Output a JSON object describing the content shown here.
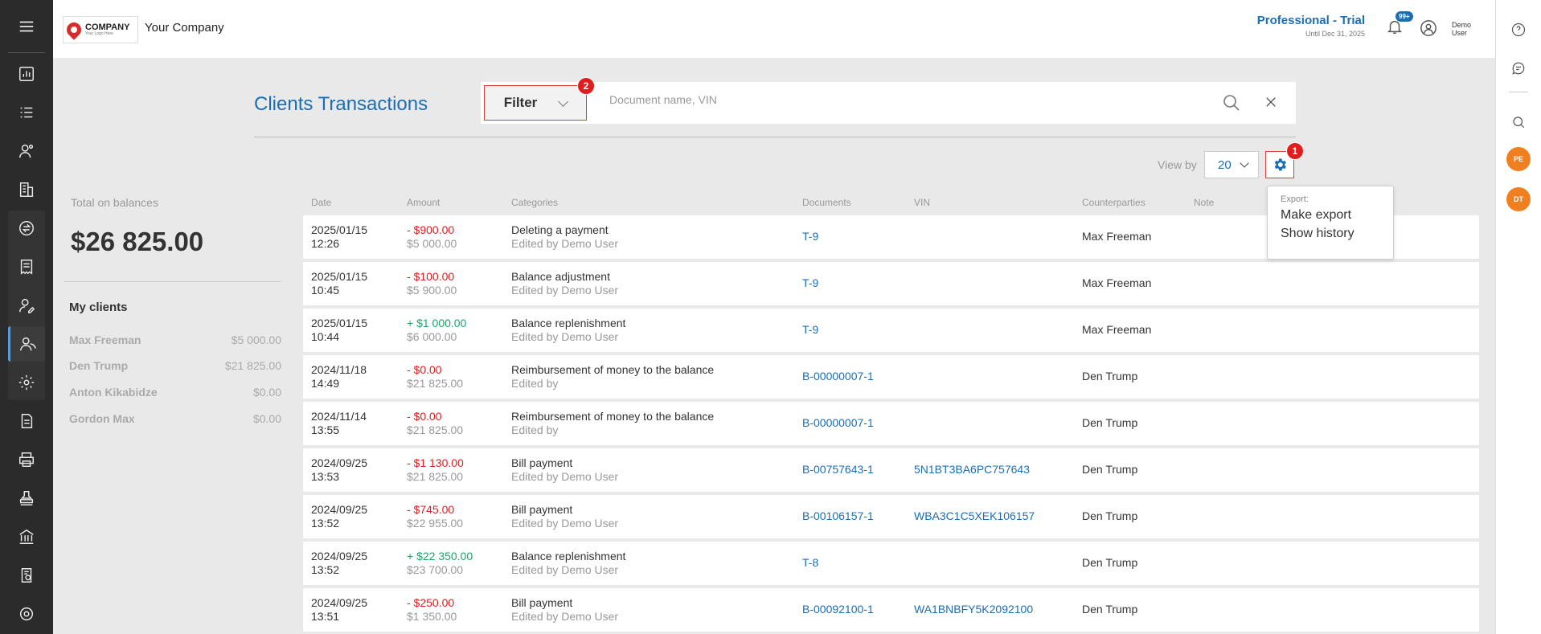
{
  "topbar": {
    "logo_line1": "COMPANY",
    "logo_line2": "Your Logo Here",
    "company_name": "Your Company",
    "plan_title": "Professional - Trial",
    "plan_until": "Until Dec 31, 2025",
    "notifications_badge": "99+",
    "user_name": "Demo User"
  },
  "sidebar": {
    "icons": [
      "menu-icon",
      "dashboard-icon",
      "tasks-icon",
      "customers-icon",
      "buildings-icon",
      "exchange-icon",
      "invoice-icon",
      "user-edit-icon",
      "clients-icon",
      "settings-cog-icon",
      "document-icon",
      "printer-icon",
      "stamp-icon",
      "bank-icon",
      "report-icon",
      "gear-icon"
    ]
  },
  "rail": {
    "avatars": [
      "PE",
      "DT"
    ]
  },
  "page": {
    "title": "Clients Transactions",
    "filter_label": "Filter",
    "search_placeholder": "Document name, VIN",
    "marker_filter": "2",
    "marker_settings": "1",
    "viewby_label": "View by",
    "viewby_value": "20"
  },
  "export_menu": {
    "heading": "Export:",
    "make_export": "Make export",
    "show_history": "Show history"
  },
  "balances": {
    "label": "Total on balances",
    "total": "$26 825.00",
    "clients_title": "My clients",
    "clients": [
      {
        "name": "Max Freeman",
        "value": "$5 000.00"
      },
      {
        "name": "Den Trump",
        "value": "$21 825.00"
      },
      {
        "name": "Anton Kikabidze",
        "value": "$0.00"
      },
      {
        "name": "Gordon Max",
        "value": "$0.00"
      }
    ]
  },
  "table": {
    "headers": {
      "date": "Date",
      "amount": "Amount",
      "categories": "Categories",
      "documents": "Documents",
      "vin": "VIN",
      "counterparties": "Counterparties",
      "note": "Note"
    },
    "rows": [
      {
        "date": "2025/01/15",
        "time": "12:26",
        "amount": "- $900.00",
        "sign": "neg",
        "balance": "$5 000.00",
        "category": "Deleting a payment",
        "edited": "Edited by Demo User",
        "document": "T-9",
        "vin": "",
        "counterparty": "Max Freeman"
      },
      {
        "date": "2025/01/15",
        "time": "10:45",
        "amount": "- $100.00",
        "sign": "neg",
        "balance": "$5 900.00",
        "category": "Balance adjustment",
        "edited": "Edited by Demo User",
        "document": "T-9",
        "vin": "",
        "counterparty": "Max Freeman"
      },
      {
        "date": "2025/01/15",
        "time": "10:44",
        "amount": "+ $1 000.00",
        "sign": "pos",
        "balance": "$6 000.00",
        "category": "Balance replenishment",
        "edited": "Edited by Demo User",
        "document": "T-9",
        "vin": "",
        "counterparty": "Max Freeman"
      },
      {
        "date": "2024/11/18",
        "time": "14:49",
        "amount": "- $0.00",
        "sign": "neg",
        "balance": "$21 825.00",
        "category": "Reimbursement of money to the balance",
        "edited": "Edited by",
        "document": "B-00000007-1",
        "vin": "",
        "counterparty": "Den Trump"
      },
      {
        "date": "2024/11/14",
        "time": "13:55",
        "amount": "- $0.00",
        "sign": "neg",
        "balance": "$21 825.00",
        "category": "Reimbursement of money to the balance",
        "edited": "Edited by",
        "document": "B-00000007-1",
        "vin": "",
        "counterparty": "Den Trump"
      },
      {
        "date": "2024/09/25",
        "time": "13:53",
        "amount": "- $1 130.00",
        "sign": "neg",
        "balance": "$21 825.00",
        "category": "Bill payment",
        "edited": "Edited by Demo User",
        "document": "B-00757643-1",
        "vin": "5N1BT3BA6PC757643",
        "counterparty": "Den Trump"
      },
      {
        "date": "2024/09/25",
        "time": "13:52",
        "amount": "- $745.00",
        "sign": "neg",
        "balance": "$22 955.00",
        "category": "Bill payment",
        "edited": "Edited by Demo User",
        "document": "B-00106157-1",
        "vin": "WBA3C1C5XEK106157",
        "counterparty": "Den Trump"
      },
      {
        "date": "2024/09/25",
        "time": "13:52",
        "amount": "+ $22 350.00",
        "sign": "pos",
        "balance": "$23 700.00",
        "category": "Balance replenishment",
        "edited": "Edited by Demo User",
        "document": "T-8",
        "vin": "",
        "counterparty": "Den Trump"
      },
      {
        "date": "2024/09/25",
        "time": "13:51",
        "amount": "- $250.00",
        "sign": "neg",
        "balance": "$1 350.00",
        "category": "Bill payment",
        "edited": "Edited by Demo User",
        "document": "B-00092100-1",
        "vin": "WA1BNBFY5K2092100",
        "counterparty": "Den Trump"
      }
    ]
  },
  "colors": {
    "accent": "#1a6eb5",
    "negative": "#e01e1e",
    "positive": "#1aa56b",
    "sidebar_bg": "#2b2b2b",
    "avatar": "#f0801f"
  }
}
